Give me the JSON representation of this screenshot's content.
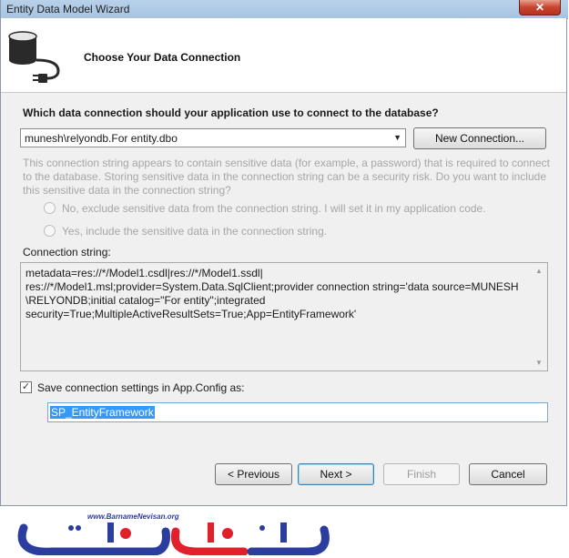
{
  "window": {
    "title": "Entity Data Model Wizard",
    "close_glyph": "✕"
  },
  "header": {
    "title": "Choose Your Data Connection",
    "icon": "database-connection-icon"
  },
  "main": {
    "question": "Which data connection should your application use to connect to the database?",
    "connection_select": {
      "value": "munesh\\relyondb.For entity.dbo"
    },
    "new_connection_label": "New Connection...",
    "info_text": "This connection string appears to contain sensitive data (for example, a password) that is required to connect to the database. Storing sensitive data in the connection string can be a security risk. Do you want to include this sensitive data in the connection string?",
    "radio_exclude": "No, exclude sensitive data from the connection string. I will set it in my application code.",
    "radio_include": "Yes, include the sensitive data in the connection string.",
    "connection_string_label": "Connection string:",
    "connection_string": "metadata=res://*/Model1.csdl|res://*/Model1.ssdl|\nres://*/Model1.msl;provider=System.Data.SqlClient;provider connection string='data source=MUNESH\n\\RELYONDB;initial catalog=\"For entity\";integrated\nsecurity=True;MultipleActiveResultSets=True;App=EntityFramework'",
    "save_checkbox": {
      "label": "Save connection settings in App.Config as:",
      "checked": true
    },
    "config_name": "SP_EntityFramework"
  },
  "footer": {
    "previous": "< Previous",
    "next": "Next >",
    "finish": "Finish",
    "cancel": "Cancel"
  },
  "watermark": {
    "url": "www.BarnameNevisan.org"
  },
  "colors": {
    "selection": "#3399ff",
    "logo_blue": "#2b3ea0",
    "logo_red": "#e0202a"
  }
}
